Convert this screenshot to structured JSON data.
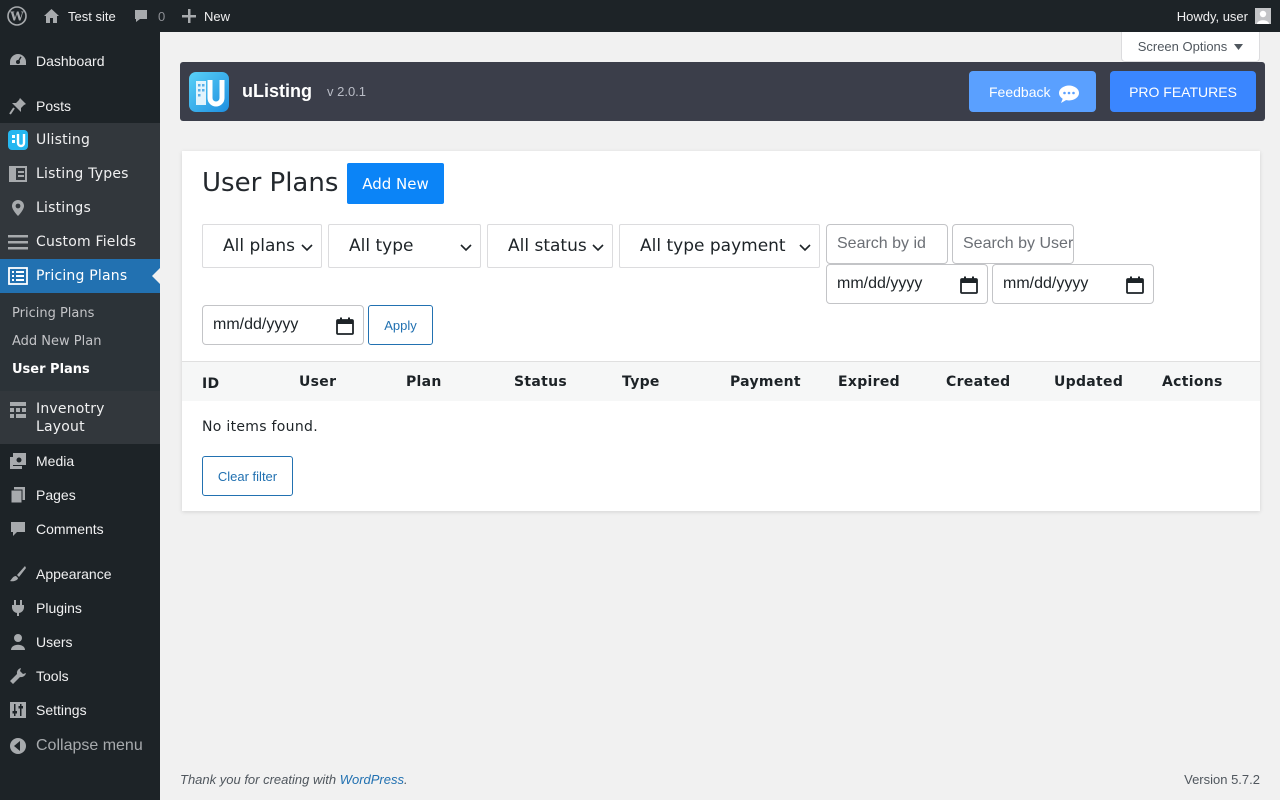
{
  "adminbar": {
    "site_name": "Test site",
    "comments_count": "0",
    "new_label": "New",
    "howdy": "Howdy, user"
  },
  "sidebar": {
    "items": [
      {
        "label": "Dashboard",
        "icon": "dashboard-icon"
      },
      {
        "label": "Posts",
        "icon": "pushpin-icon"
      },
      {
        "label": "Ulisting",
        "icon": "ulisting-logo-icon"
      },
      {
        "label": "Listing Types",
        "icon": "layout-icon"
      },
      {
        "label": "Listings",
        "icon": "location-pin-icon"
      },
      {
        "label": "Custom Fields",
        "icon": "menu-lines-icon"
      },
      {
        "label": "Pricing Plans",
        "icon": "list-view-icon"
      },
      {
        "label": "Invenotry Layout",
        "icon": "grid-icon"
      },
      {
        "label": "Media",
        "icon": "media-icon"
      },
      {
        "label": "Pages",
        "icon": "pages-icon"
      },
      {
        "label": "Comments",
        "icon": "comment-icon"
      },
      {
        "label": "Appearance",
        "icon": "brush-icon"
      },
      {
        "label": "Plugins",
        "icon": "plug-icon"
      },
      {
        "label": "Users",
        "icon": "user-icon"
      },
      {
        "label": "Tools",
        "icon": "wrench-icon"
      },
      {
        "label": "Settings",
        "icon": "sliders-icon"
      },
      {
        "label": "Collapse menu",
        "icon": "collapse-icon"
      }
    ],
    "submenu": [
      "Pricing Plans",
      "Add New Plan",
      "User Plans"
    ]
  },
  "screen_options": "Screen Options",
  "ulisting": {
    "title": "uListing",
    "version": "v 2.0.1",
    "feedback_label": "Feedback",
    "pro_label": "PRO FEATURES"
  },
  "main": {
    "title": "User Plans",
    "add_new": "Add New",
    "filters": {
      "plans": "All plans",
      "type": "All type",
      "status": "All status",
      "payment": "All type payment",
      "search_id_placeholder": "Search by id",
      "search_user_placeholder": "Search by User",
      "date_placeholder": "mm/dd/yyyy",
      "apply": "Apply"
    },
    "columns": [
      "ID",
      "User",
      "Plan",
      "Status",
      "Type",
      "Payment",
      "Expired",
      "Created",
      "Updated",
      "Actions"
    ],
    "empty_message": "No items found.",
    "clear_filter": "Clear filter"
  },
  "footer": {
    "thanks_prefix": "Thank you for creating with ",
    "wordpress_link": "WordPress",
    "thanks_suffix": ".",
    "version": "Version 5.7.2"
  },
  "colors": {
    "admin_dark": "#1d2327",
    "accent_blue": "#2271b1",
    "ulisting_header": "#3b3e4a",
    "add_new_blue": "#0b84f7"
  }
}
